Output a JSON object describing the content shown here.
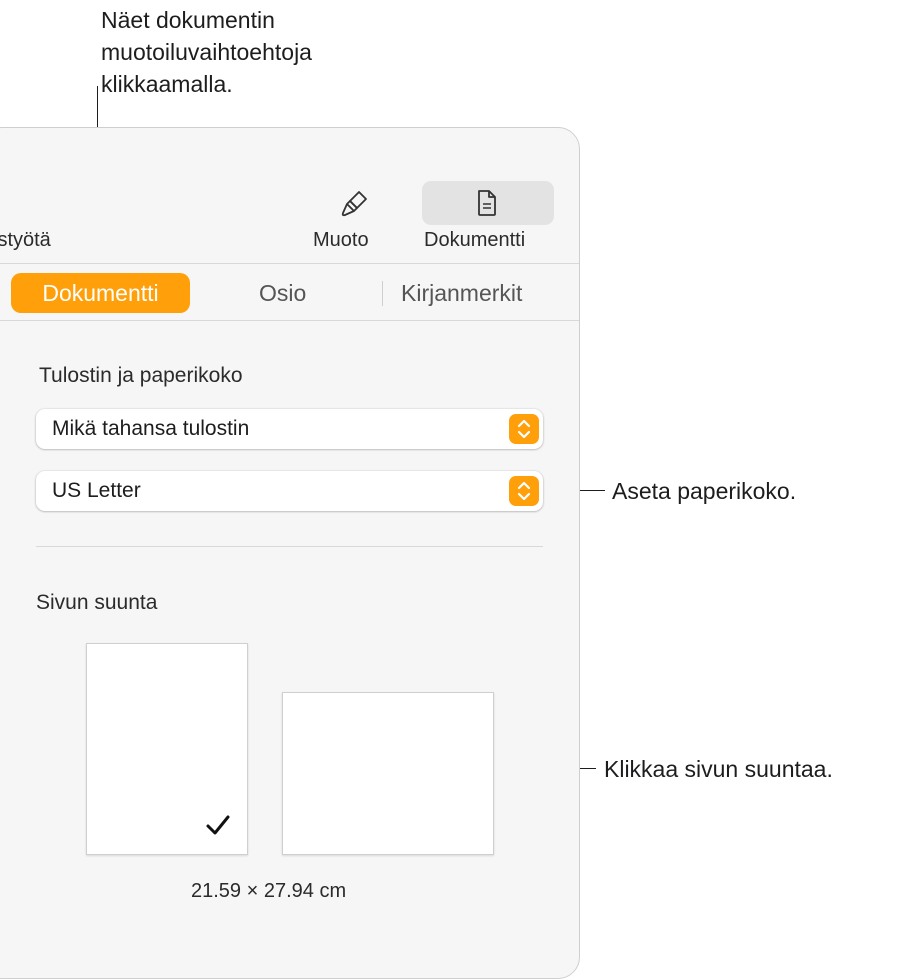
{
  "callouts": {
    "top": [
      "Näet dokumentin",
      "muotoiluvaihtoehtoja",
      "klikkaamalla."
    ],
    "paper_size": "Aseta paperikoko.",
    "orientation": "Klikkaa sivun suuntaa."
  },
  "toolbar": {
    "partial_label": "istyötä",
    "format_label": "Muoto",
    "document_label": "Dokumentti",
    "format_icon": "paintbrush-icon",
    "document_icon": "document-icon"
  },
  "tabs": [
    {
      "label": "Dokumentti",
      "selected": true
    },
    {
      "label": "Osio",
      "selected": false
    },
    {
      "label": "Kirjanmerkit",
      "selected": false
    }
  ],
  "printer_section": {
    "title": "Tulostin ja paperikoko",
    "printer_value": "Mikä tahansa tulostin",
    "paper_value": "US Letter"
  },
  "orientation_section": {
    "title": "Sivun suunta",
    "options": [
      {
        "label": "portrait",
        "selected": true
      },
      {
        "label": "landscape",
        "selected": false
      }
    ],
    "dimensions": "21.59 × 27.94 cm"
  },
  "colors": {
    "accent": "#ff9f0a",
    "panel_bg": "#f6f6f6"
  }
}
